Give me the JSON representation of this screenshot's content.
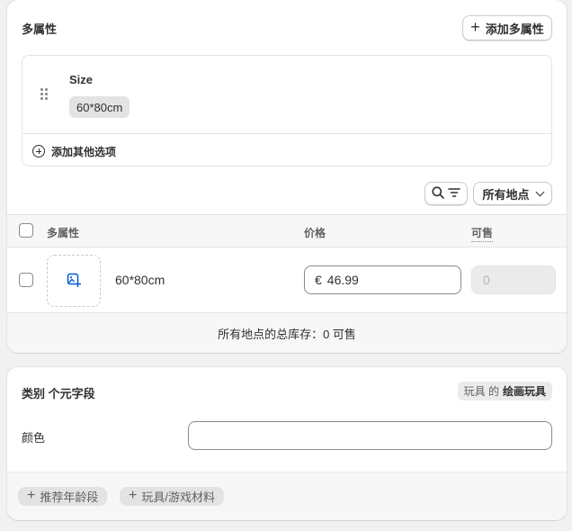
{
  "variants_card": {
    "title": "多属性",
    "add_variant_label": "添加多属性",
    "option": {
      "name": "Size",
      "values": [
        "60*80cm"
      ]
    },
    "add_other_option_label": "添加其他选项",
    "locations_button_label": "所有地点",
    "table": {
      "headers": {
        "variant": "多属性",
        "price": "价格",
        "available": "可售"
      },
      "rows": [
        {
          "name": "60*80cm",
          "currency_symbol": "€",
          "price": "46.99",
          "available_placeholder": "0"
        }
      ]
    },
    "total_inventory_text": "所有地点的总库存：0 可售"
  },
  "metafields_card": {
    "title": "类别 个元字段",
    "category_prefix": "玩具 的",
    "category_name": "绘画玩具",
    "field_label": "颜色",
    "suggested_fields": [
      "推荐年龄段",
      "玩具/游戏材料"
    ]
  },
  "icons": {
    "add": "plus-icon",
    "drag": "drag-handle-icon",
    "add_option": "circle-plus-icon",
    "search": "search-icon",
    "filter": "filter-icon",
    "dropdown": "chevron-down-icon",
    "image_add": "image-add-icon"
  },
  "colors": {
    "accent_blue": "#005bd3",
    "text": "#303030",
    "muted": "#616161"
  }
}
